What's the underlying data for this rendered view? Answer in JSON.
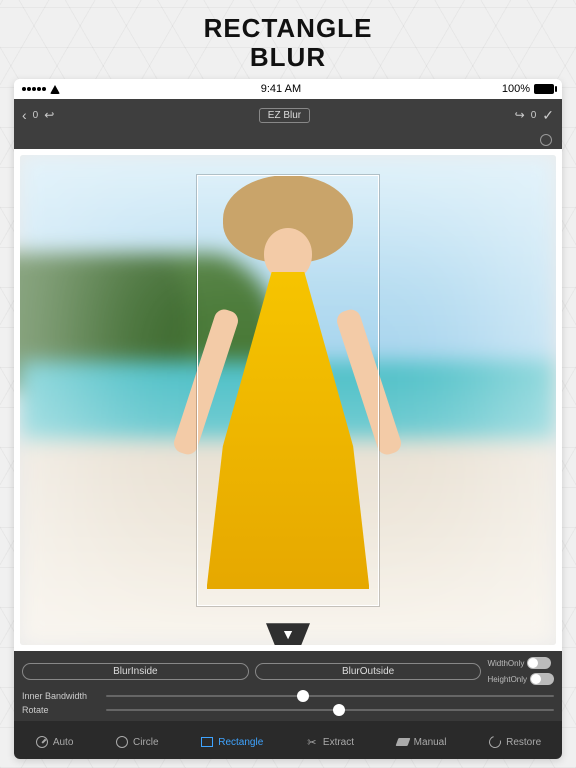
{
  "promo": {
    "line1": "RECTANGLE",
    "line2": "BLUR"
  },
  "statusbar": {
    "time": "9:41 AM",
    "battery": "100%"
  },
  "titlebar": {
    "undo_count": "0",
    "redo_count": "0",
    "app_name": "EZ Blur"
  },
  "segments": {
    "blur_inside": "BlurInside",
    "blur_outside": "BlurOutside"
  },
  "toggles": {
    "width_only": "WidthOnly",
    "height_only": "HeightOnly"
  },
  "sliders": {
    "inner_bandwidth": {
      "label": "Inner Bandwidth",
      "value": 0.44
    },
    "rotate": {
      "label": "Rotate",
      "value": 0.52
    }
  },
  "tools": {
    "auto": "Auto",
    "circle": "Circle",
    "rectangle": "Rectangle",
    "extract": "Extract",
    "manual": "Manual",
    "restore": "Restore"
  }
}
